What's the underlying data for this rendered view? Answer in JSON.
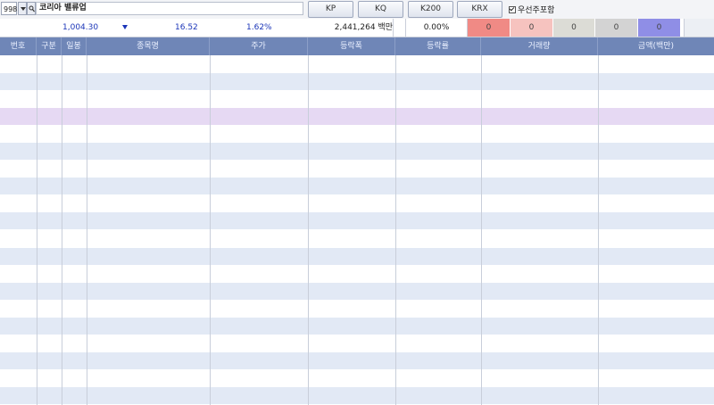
{
  "toolbar": {
    "code": "998",
    "stock_name": "코리아 밸류업",
    "buttons": [
      "KP",
      "KQ",
      "K200",
      "KRX"
    ],
    "pref_label": "우선주포함",
    "pref_checked": true
  },
  "info": {
    "price": "1,004.30",
    "change": "16.52",
    "change_pct": "1.62%",
    "amount": "2,441,264 백만",
    "ratio": "0.00%",
    "counts": [
      {
        "value": "0",
        "color": "#f08a85"
      },
      {
        "value": "0",
        "color": "#f6c3bf"
      },
      {
        "value": "0",
        "color": "#dcdcd6"
      },
      {
        "value": "0",
        "color": "#d3d3d3"
      },
      {
        "value": "0",
        "color": "#8f8ee6"
      }
    ]
  },
  "grid": {
    "headers": [
      "번호",
      "구분",
      "일봉",
      "종목명",
      "주가",
      "등락폭",
      "등락률",
      "거래량",
      "금액(백만)"
    ],
    "row_colors": {
      "white": "#ffffff",
      "blue": "#e2e9f5",
      "selected": "#e6d9f3"
    }
  }
}
